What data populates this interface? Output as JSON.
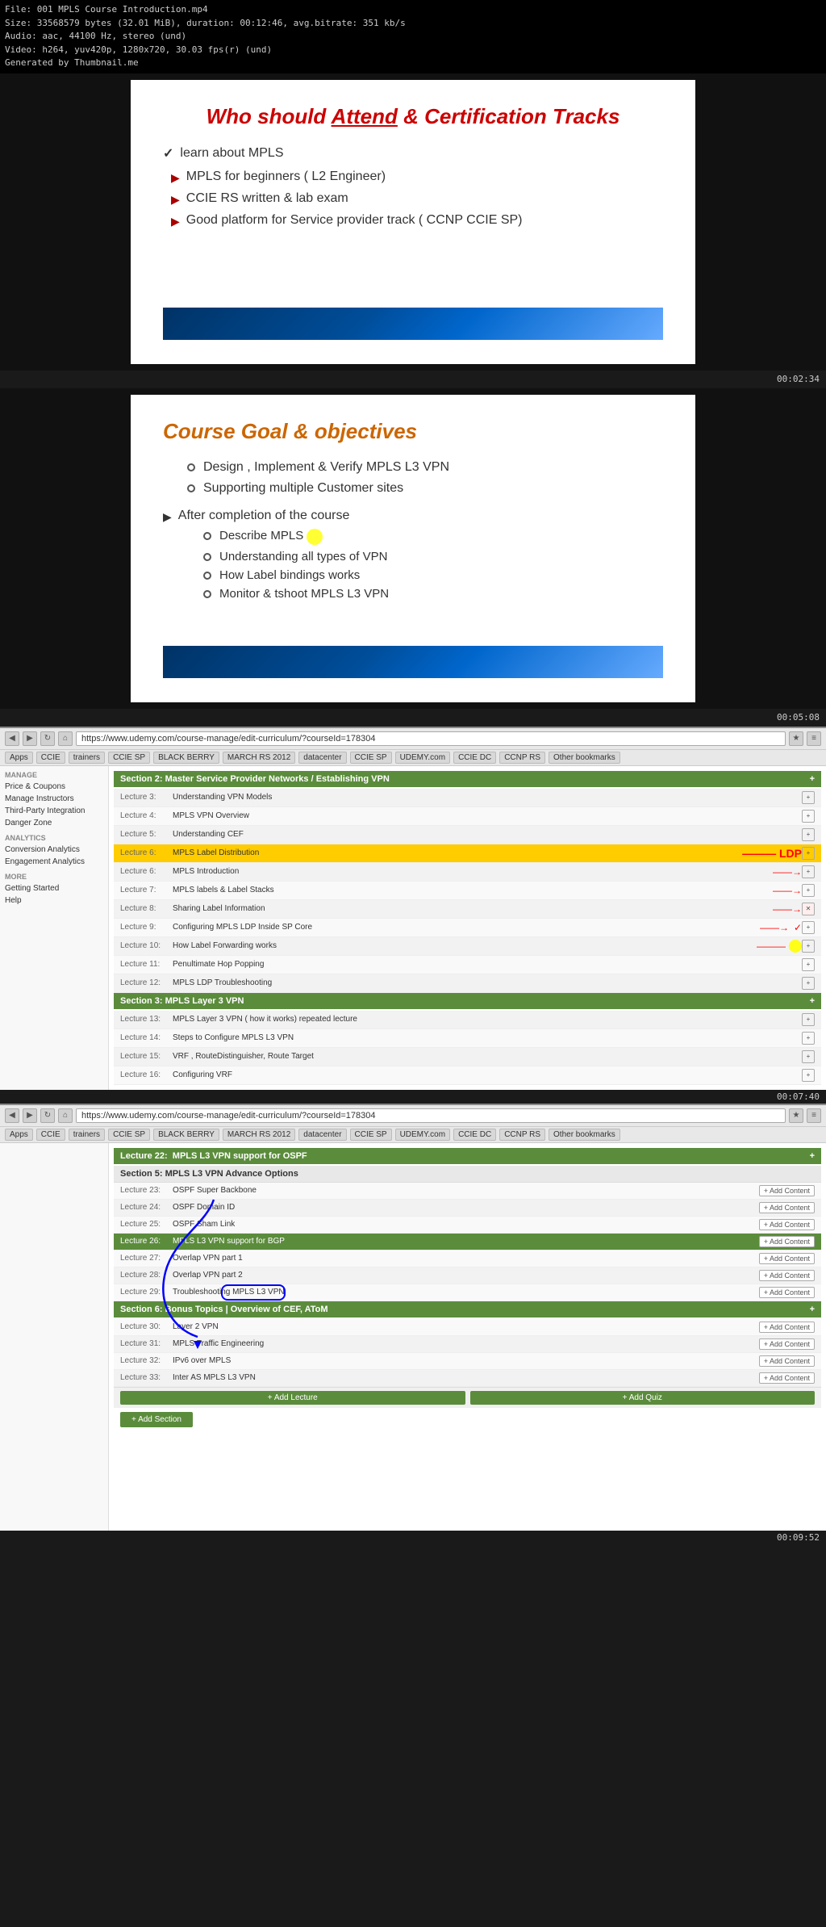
{
  "fileInfo": {
    "line1": "File: 001 MPLS Course Introduction.mp4",
    "line2": "Size: 33568579 bytes (32.01 MiB), duration: 00:12:46, avg.bitrate: 351 kb/s",
    "line3": "Audio: aac, 44100 Hz, stereo (und)",
    "line4": "Video: h264, yuv420p, 1280x720, 30.03 fps(r) (und)",
    "line5": "Generated by Thumbnail.me"
  },
  "slide1": {
    "title": "Who should Attend & Certification Tracks",
    "timestamp": "00:02:34",
    "checkItem": "learn about MPLS",
    "bullets": [
      "MPLS for beginners  ( L2 Engineer)",
      "CCIE RS written & lab exam",
      "Good platform for Service provider track ( CCNP CCIE SP)"
    ]
  },
  "slide2": {
    "title": "Course Goal & objectives",
    "timestamp": "00:05:08",
    "bullets": [
      "Design , Implement & Verify MPLS L3 VPN",
      "Supporting multiple Customer sites"
    ],
    "sectionTitle": "After completion of the course",
    "subBullets": [
      "Describe MPLS",
      "Understanding all types of VPN",
      "How Label bindings works",
      "Monitor & tshoot MPLS L3 VPN"
    ]
  },
  "browser1": {
    "timestamp": "00:07:40",
    "url": "https://www.udemy.com/course-manage/edit-curriculum/?courseId=178304",
    "bookmarks": [
      "Apps",
      "CCIE",
      "trainers",
      "CCIE SP",
      "BLACK BERRY",
      "MARCH RS 2012",
      "datacenter",
      "CCIE SP",
      "UDEMY.com",
      "CCIE DC",
      "CCNP RS",
      "Other bookmarks"
    ],
    "sidebar": {
      "sections": [
        {
          "label": "MANAGE",
          "items": [
            "Price & Coupons",
            "Manage Instructors",
            "Third-Party Integration",
            "Danger Zone"
          ]
        },
        {
          "label": "ANALYTICS",
          "items": [
            "Conversion Analytics",
            "Engagement Analytics"
          ]
        },
        {
          "label": "MORE",
          "items": [
            "Getting Started",
            "Help"
          ]
        }
      ]
    },
    "sections": [
      {
        "name": "Section 2: Service Provider Networks",
        "highlighted": true,
        "lectures": [
          {
            "num": "Lecture 3:",
            "title": "Understanding VPN Models",
            "arrow": false,
            "check": false,
            "ldp": false
          },
          {
            "num": "Lecture 4:",
            "title": "MPLS VPN Overview",
            "arrow": false,
            "check": false,
            "ldp": false
          },
          {
            "num": "Lecture 5:",
            "title": "Understanding CEF",
            "arrow": false,
            "check": false,
            "ldp": false
          },
          {
            "num": "Lecture 6:",
            "title": "MPLS Label Distribution",
            "arrow": false,
            "check": false,
            "ldp": true,
            "annotationHighlight": true
          },
          {
            "num": "Lecture 6:",
            "title": "MPLS Introduction",
            "arrow": true,
            "check": false,
            "ldp": false
          },
          {
            "num": "Lecture 7:",
            "title": "MPLS labels & Label Stacks",
            "arrow": true,
            "check": false,
            "ldp": false
          },
          {
            "num": "Lecture 8:",
            "title": "Sharing Label Information",
            "arrow": true,
            "check": false,
            "ldp": false,
            "hasX": true
          },
          {
            "num": "Lecture 9:",
            "title": "Configuring MPLS LDP Inside SP Core",
            "arrow": true,
            "check": true,
            "ldp": false
          },
          {
            "num": "Lecture 10:",
            "title": "How Label Forwarding works",
            "arrow": true,
            "check": false,
            "ldp": false,
            "cursor": true
          },
          {
            "num": "Lecture 11:",
            "title": "Penultimate Hop Popping",
            "arrow": false,
            "check": false,
            "ldp": false
          },
          {
            "num": "Lecture 12:",
            "title": "MPLS LDP Troubleshooting",
            "arrow": false,
            "check": false,
            "ldp": false
          }
        ]
      },
      {
        "name": "Section 3: MPLS Layer 3 VPN",
        "highlighted": true,
        "lectures": [
          {
            "num": "Lecture 13:",
            "title": "MPLS Layer 3 VPN ( how it works) repeated lecture",
            "arrow": false
          },
          {
            "num": "Lecture 14:",
            "title": "Steps to Configure MPLS L3 VPN",
            "arrow": false
          },
          {
            "num": "Lecture 15:",
            "title": "VRF , RouteDistinguisher, Route Target",
            "arrow": false
          },
          {
            "num": "Lecture 16:",
            "title": "Configuring VRF",
            "arrow": false
          }
        ]
      }
    ]
  },
  "browser2": {
    "timestamp": "00:09:52",
    "url": "https://www.udemy.com/course-manage/edit-curriculum/?courseId=178304",
    "sections": [
      {
        "name": "Lecture 22:",
        "title": "MPLS L3 VPN support for OSPF",
        "highlighted": true
      },
      {
        "name": "Section 5: MPLS L3 VPN Advance Options",
        "highlighted": false,
        "lectures": [
          {
            "num": "Lecture 23:",
            "title": "OSPF Super Backbone"
          },
          {
            "num": "Lecture 24:",
            "title": "OSPF Domain ID"
          },
          {
            "num": "Lecture 25:",
            "title": "OSPF Sham Link"
          },
          {
            "num": "Lecture 26:",
            "title": "MPLS L3 VPN support for BGP",
            "highlighted": true
          },
          {
            "num": "Lecture 27:",
            "title": "Overlap VPN part 1"
          },
          {
            "num": "Lecture 28:",
            "title": "Overlap VPN part 2"
          },
          {
            "num": "Lecture 29:",
            "title": "Troubleshooting MPLS L3 VPN",
            "circled": true
          }
        ]
      },
      {
        "name": "Section 6: Bonus Topics | Overview of CEF, AToM",
        "highlighted": true,
        "lectures": [
          {
            "num": "Lecture 30:",
            "title": "Layer 2 VPN"
          },
          {
            "num": "Lecture 31:",
            "title": "MPLS Traffic Engineering"
          },
          {
            "num": "Lecture 32:",
            "title": "IPv6 over MPLS"
          },
          {
            "num": "Lecture 33:",
            "title": "Inter AS MPLS L3 VPN"
          }
        ]
      }
    ],
    "addLectureLabel": "+ Add Lecture",
    "addQuizLabel": "+ Add Quiz",
    "addSectionLabel": "+ Add Section"
  }
}
